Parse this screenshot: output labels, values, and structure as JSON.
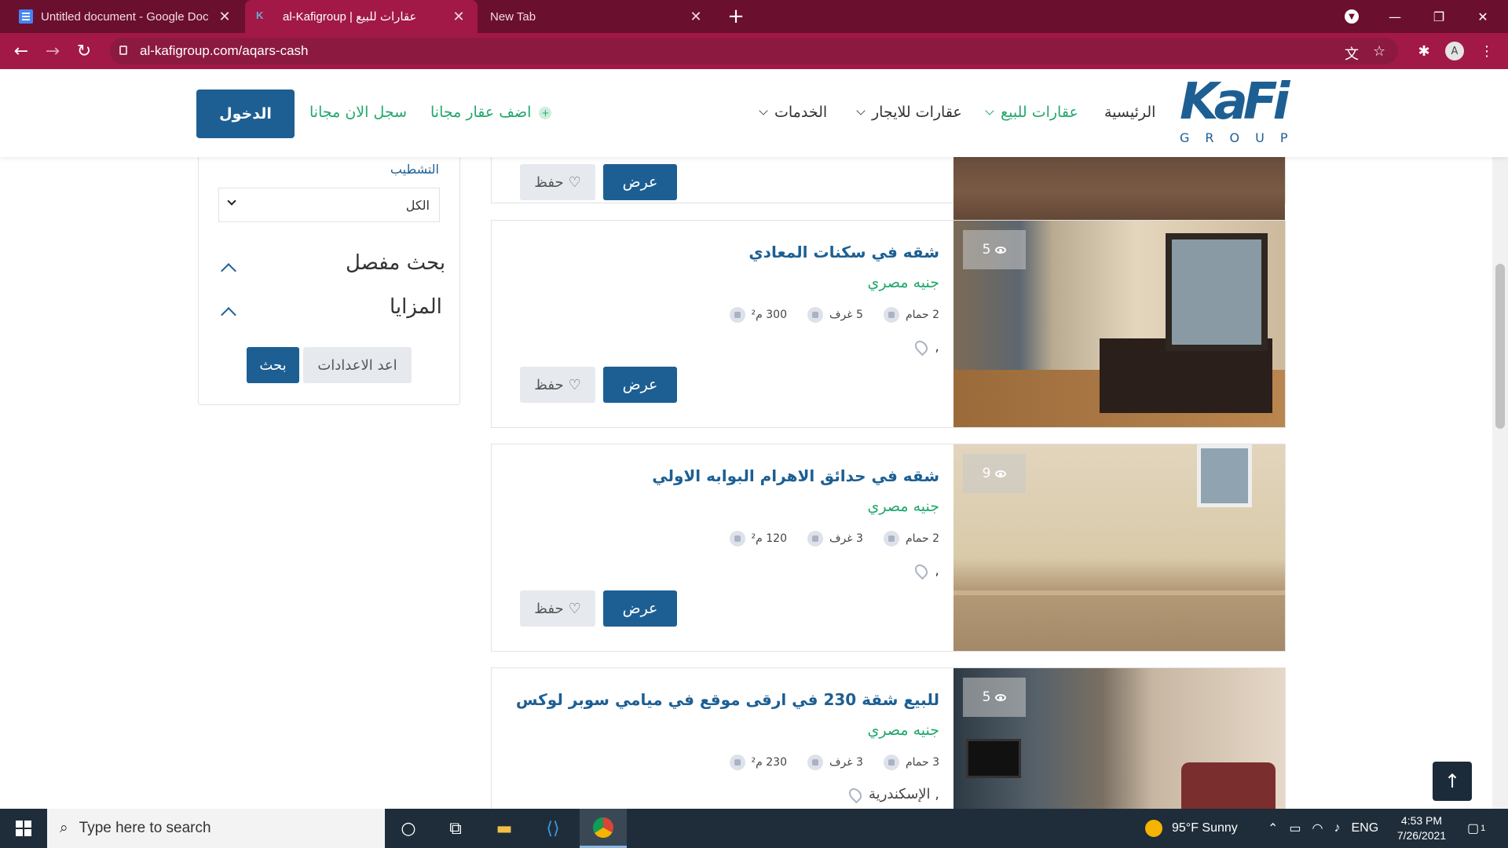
{
  "browser": {
    "tabs": [
      {
        "title": "Untitled document - Google Doc",
        "active": false
      },
      {
        "title": "al-Kafigroup | عقارات للبيع",
        "active": true
      },
      {
        "title": "New Tab",
        "active": false
      }
    ],
    "url": "al-kafigroup.com/aqars-cash",
    "profile_initial": "A",
    "accent_color": "#a21847"
  },
  "site": {
    "logo_mark": "KaFi",
    "logo_group": "GROUP",
    "nav": {
      "home": "الرئيسية",
      "for_sale": "عقارات للبيع",
      "for_rent": "عقارات للايجار",
      "services": "الخدمات"
    },
    "add_property": "اضف عقار مجانا",
    "register": "سجل الان مجانا",
    "login": "الدخول",
    "brand_color": "#1d5f93",
    "accent_green": "#21a86b"
  },
  "sidebar": {
    "finishing_label": "التشطيب",
    "finishing_value": "الكل",
    "advanced_search": "بحث مفصل",
    "features": "المزايا",
    "search_button": "بحث",
    "reset_button": "اعد الاعدادات"
  },
  "listings": [
    {
      "title": "",
      "view_button": "عرض",
      "save_button": "حفظ"
    },
    {
      "views": "5",
      "title": "شقه في سكنات المعادي",
      "price": "جنيه مصري",
      "area": "300 م²",
      "rooms": "5 غرف",
      "baths": "2 حمام",
      "location": ",",
      "view_button": "عرض",
      "save_button": "حفظ"
    },
    {
      "views": "9",
      "title": "شقه في حدائق الاهرام البوابه الاولي",
      "price": "جنيه مصري",
      "area": "120 م²",
      "rooms": "3 غرف",
      "baths": "2 حمام",
      "location": ",",
      "view_button": "عرض",
      "save_button": "حفظ"
    },
    {
      "views": "5",
      "title": "للبيع شقة 230 في ارقى موقع في ميامي سوبر لوكس",
      "price": "جنيه مصري",
      "area": "230 م²",
      "rooms": "3 غرف",
      "baths": "3 حمام",
      "location": ", الإسكندرية"
    }
  ],
  "taskbar": {
    "search_placeholder": "Type here to search",
    "weather": "95°F  Sunny",
    "language": "ENG",
    "time": "4:53 PM",
    "date": "7/26/2021",
    "notifications": "1"
  }
}
